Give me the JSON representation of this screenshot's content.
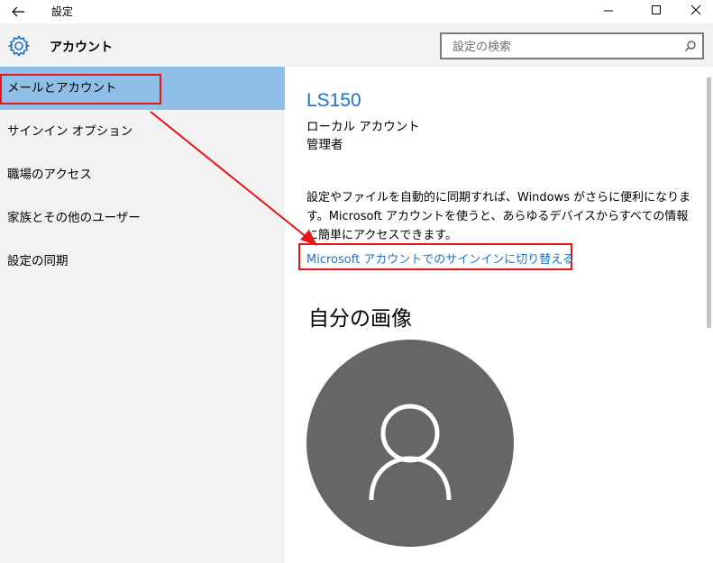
{
  "window": {
    "title": "設定",
    "icons": {
      "back": "back-arrow-icon",
      "minimize": "minimize-icon",
      "maximize": "maximize-icon",
      "close": "close-icon"
    }
  },
  "header": {
    "title": "アカウント",
    "icon": "gear-icon",
    "search_placeholder": "設定の検索",
    "search_value": ""
  },
  "sidebar": {
    "items": [
      {
        "label": "メールとアカウント",
        "selected": true
      },
      {
        "label": "サインイン オプション",
        "selected": false
      },
      {
        "label": "職場のアクセス",
        "selected": false
      },
      {
        "label": "家族とその他のユーザー",
        "selected": false
      },
      {
        "label": "設定の同期",
        "selected": false
      }
    ]
  },
  "main": {
    "user_name": "LS150",
    "account_type": "ローカル アカウント",
    "account_role": "管理者",
    "description": "設定やファイルを自動的に同期すれば、Windows がさらに便利になります。Microsoft アカウントを使うと、あらゆるデバイスからすべての情報に簡単にアクセスできます。",
    "switch_link": "Microsoft アカウントでのサインインに切り替える",
    "picture_section_title": "自分の画像",
    "avatar_icon": "user-silhouette-icon"
  },
  "colors": {
    "accent": "#1b74c8",
    "selected_nav": "#8fbfe6",
    "annotation": "#e8141c",
    "avatar_bg": "#666666"
  }
}
